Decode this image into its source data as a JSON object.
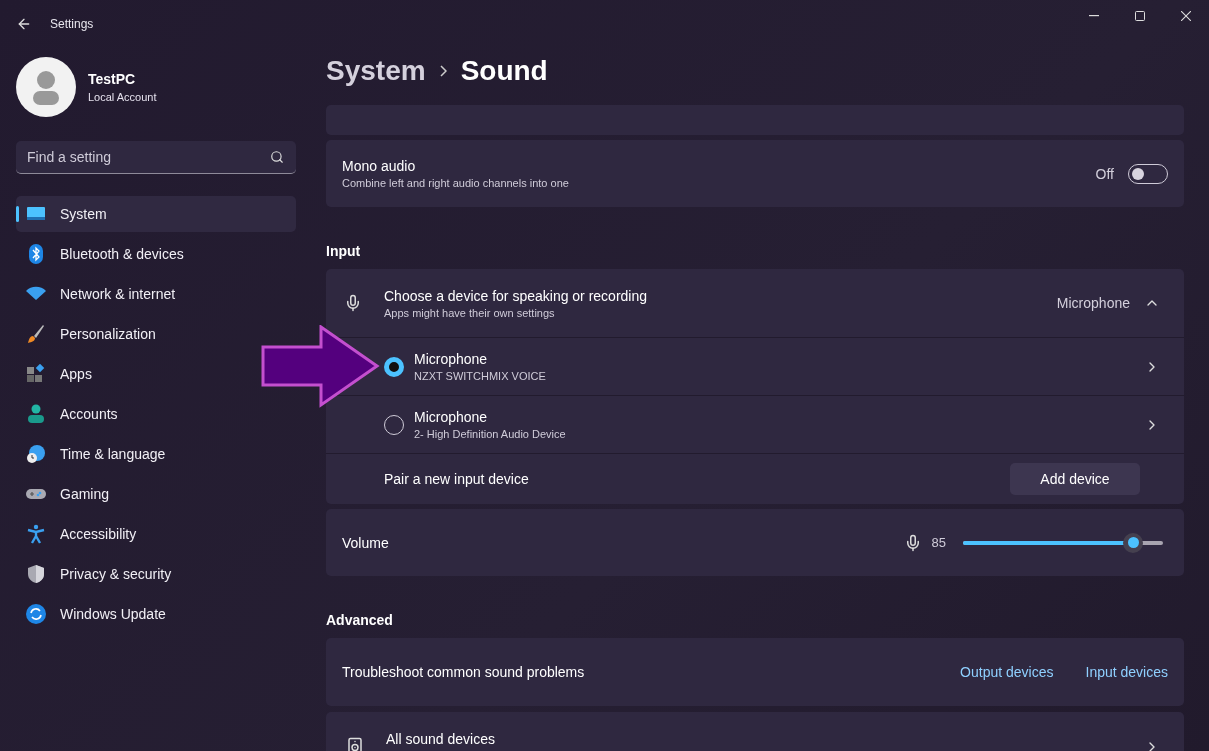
{
  "window": {
    "title": "Settings"
  },
  "account": {
    "name": "TestPC",
    "type": "Local Account"
  },
  "search": {
    "placeholder": "Find a setting"
  },
  "sidebar": {
    "items": [
      {
        "label": "System",
        "kind": "system",
        "selected": true
      },
      {
        "label": "Bluetooth & devices",
        "kind": "bluetooth",
        "selected": false
      },
      {
        "label": "Network & internet",
        "kind": "network",
        "selected": false
      },
      {
        "label": "Personalization",
        "kind": "brush",
        "selected": false
      },
      {
        "label": "Apps",
        "kind": "apps",
        "selected": false
      },
      {
        "label": "Accounts",
        "kind": "person",
        "selected": false
      },
      {
        "label": "Time & language",
        "kind": "time",
        "selected": false
      },
      {
        "label": "Gaming",
        "kind": "gaming",
        "selected": false
      },
      {
        "label": "Accessibility",
        "kind": "accessibility",
        "selected": false
      },
      {
        "label": "Privacy & security",
        "kind": "shield",
        "selected": false
      },
      {
        "label": "Windows Update",
        "kind": "update",
        "selected": false
      }
    ]
  },
  "breadcrumb": [
    "System",
    "Sound"
  ],
  "mono_audio": {
    "title": "Mono audio",
    "description": "Combine left and right audio channels into one",
    "state_label": "Off",
    "on": false
  },
  "input": {
    "heading": "Input",
    "device_chooser": {
      "title": "Choose a device for speaking or recording",
      "description": "Apps might have their own settings",
      "value": "Microphone",
      "expanded": true
    },
    "devices": [
      {
        "name": "Microphone",
        "detail": "NZXT SWITCHMIX VOICE",
        "selected": true
      },
      {
        "name": "Microphone",
        "detail": "2- High Definition Audio Device",
        "selected": false
      }
    ],
    "pair": {
      "label": "Pair a new input device",
      "button": "Add device"
    },
    "volume": {
      "label": "Volume",
      "reading": "85",
      "level": 0.85
    }
  },
  "advanced": {
    "heading": "Advanced",
    "troubleshoot": {
      "label": "Troubleshoot common sound problems",
      "links": [
        "Output devices",
        "Input devices"
      ]
    },
    "all_devices": {
      "title": "All sound devices"
    }
  }
}
